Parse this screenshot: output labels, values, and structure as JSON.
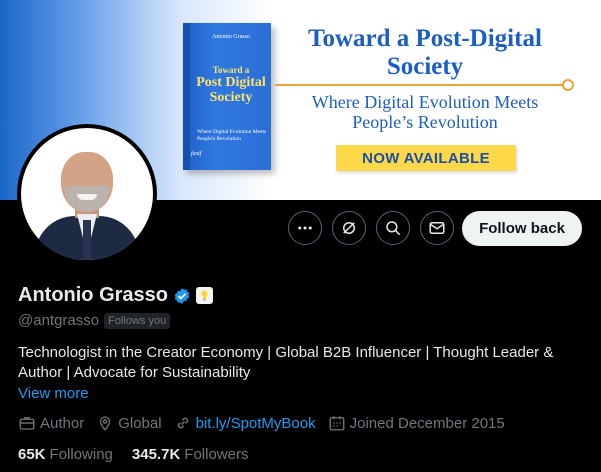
{
  "banner": {
    "book": {
      "author": "Antonio Grasso",
      "title_line1": "Toward a",
      "title_big": "Post Digital Society",
      "subtitle": "Where Digital Evolution Meets People's Revolution",
      "publisher_mark": "fastf"
    },
    "headline": "Toward a Post-Digital Society",
    "tagline": "Where Digital Evolution Meets People’s Revolution",
    "cta": "NOW AVAILABLE"
  },
  "actions": {
    "more_icon": "more-icon",
    "grok_icon": "grok-icon",
    "search_icon": "search-icon",
    "message_icon": "message-icon",
    "follow_label": "Follow back"
  },
  "profile": {
    "name": "Antonio Grasso",
    "handle": "@antgrasso",
    "follows_you": "Follows you",
    "bio": "Technologist in the Creator Economy | Global B2B Influencer | Thought Leader & Author | Advocate for Sustainability",
    "view_more": "View more",
    "meta": {
      "category": "Author",
      "location": "Global",
      "link": "bit.ly/SpotMyBook",
      "joined": "Joined December 2015"
    },
    "stats": {
      "following_count": "65K",
      "following_label": "Following",
      "followers_count": "345.7K",
      "followers_label": "Followers"
    }
  },
  "colors": {
    "accent": "#1d9bf0",
    "muted": "#71767b",
    "banner_blue": "#1c5ec7",
    "banner_yellow": "#ffd84a"
  }
}
